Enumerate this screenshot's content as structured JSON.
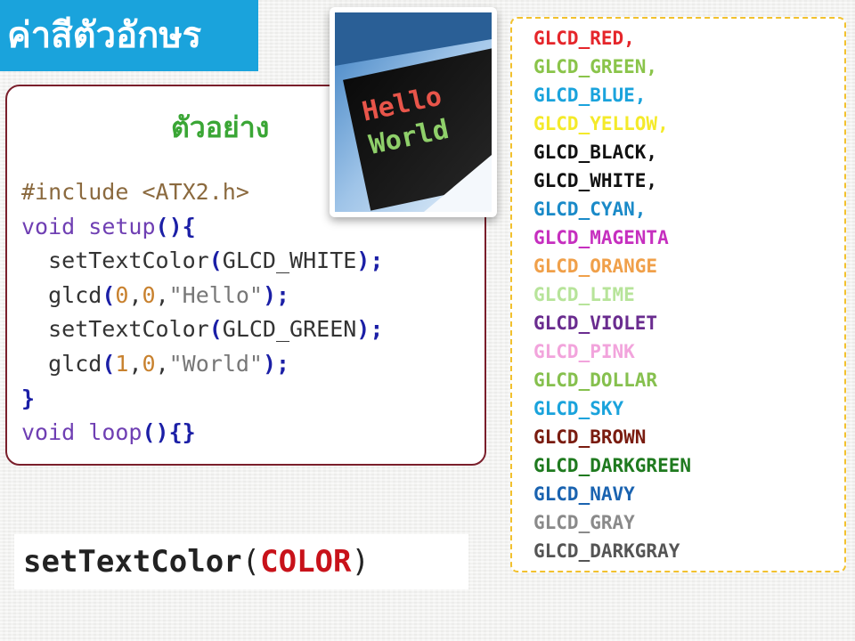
{
  "title": "ค่าสีตัวอักษร",
  "example": {
    "heading": "ตัวอย่าง",
    "code": [
      [
        {
          "t": "#include <ATX2.h>",
          "c": "pp"
        }
      ],
      [
        {
          "t": "void",
          "c": "kw"
        },
        {
          "t": " setup",
          "c": "kw"
        },
        {
          "t": "(){",
          "c": "pn"
        }
      ],
      [
        {
          "t": "  setTextColor",
          "c": "fn"
        },
        {
          "t": "(",
          "c": "pn"
        },
        {
          "t": "GLCD_WHITE",
          "c": "fn"
        },
        {
          "t": ");",
          "c": "pn"
        }
      ],
      [
        {
          "t": "  glcd",
          "c": "fn"
        },
        {
          "t": "(",
          "c": "pn"
        },
        {
          "t": "0",
          "c": "num"
        },
        {
          "t": ",",
          "c": "fn"
        },
        {
          "t": "0",
          "c": "num"
        },
        {
          "t": ",",
          "c": "fn"
        },
        {
          "t": "\"Hello\"",
          "c": "str"
        },
        {
          "t": ");",
          "c": "pn"
        }
      ],
      [
        {
          "t": "  setTextColor",
          "c": "fn"
        },
        {
          "t": "(",
          "c": "pn"
        },
        {
          "t": "GLCD_GREEN",
          "c": "fn"
        },
        {
          "t": ");",
          "c": "pn"
        }
      ],
      [
        {
          "t": "  glcd",
          "c": "fn"
        },
        {
          "t": "(",
          "c": "pn"
        },
        {
          "t": "1",
          "c": "num"
        },
        {
          "t": ",",
          "c": "fn"
        },
        {
          "t": "0",
          "c": "num"
        },
        {
          "t": ",",
          "c": "fn"
        },
        {
          "t": "\"World\"",
          "c": "str"
        },
        {
          "t": ");",
          "c": "pn"
        }
      ],
      [
        {
          "t": "}",
          "c": "pn"
        }
      ],
      [
        {
          "t": "void",
          "c": "kw"
        },
        {
          "t": " loop",
          "c": "kw"
        },
        {
          "t": "(){}",
          "c": "pn"
        }
      ]
    ]
  },
  "photo": {
    "line1": "Hello",
    "line2": "World",
    "line1_color": "#e8554a",
    "line2_color": "#8fd06a"
  },
  "colors": [
    {
      "label": "GLCD_RED,",
      "color": "#e5262b"
    },
    {
      "label": "GLCD_GREEN,",
      "color": "#8ac44a"
    },
    {
      "label": "GLCD_BLUE,",
      "color": "#1aa3dc"
    },
    {
      "label": "GLCD_YELLOW,",
      "color": "#f4ea2a"
    },
    {
      "label": "GLCD_BLACK,",
      "color": "#111111"
    },
    {
      "label": "GLCD_WHITE,",
      "color": "#111111"
    },
    {
      "label": "GLCD_CYAN,",
      "color": "#1a8ac8"
    },
    {
      "label": "GLCD_MAGENTA",
      "color": "#c62fbf"
    },
    {
      "label": "GLCD_ORANGE",
      "color": "#f0a04a"
    },
    {
      "label": "GLCD_LIME",
      "color": "#b7e49a"
    },
    {
      "label": "GLCD_VIOLET",
      "color": "#6a2c8f"
    },
    {
      "label": "GLCD_PINK",
      "color": "#f2a4dc"
    },
    {
      "label": "GLCD_DOLLAR",
      "color": "#86c04e"
    },
    {
      "label": "GLCD_SKY",
      "color": "#1aa3dc"
    },
    {
      "label": "GLCD_BROWN",
      "color": "#7a1c10"
    },
    {
      "label": "GLCD_DARKGREEN",
      "color": "#1f7a1f"
    },
    {
      "label": "GLCD_NAVY",
      "color": "#1a63b0"
    },
    {
      "label": "GLCD_GRAY",
      "color": "#8a8a8a"
    },
    {
      "label": "GLCD_DARKGRAY",
      "color": "#555555"
    }
  ],
  "signature": {
    "fname": "setTextColor",
    "open": "(",
    "arg": "COLOR",
    "close": ")"
  }
}
